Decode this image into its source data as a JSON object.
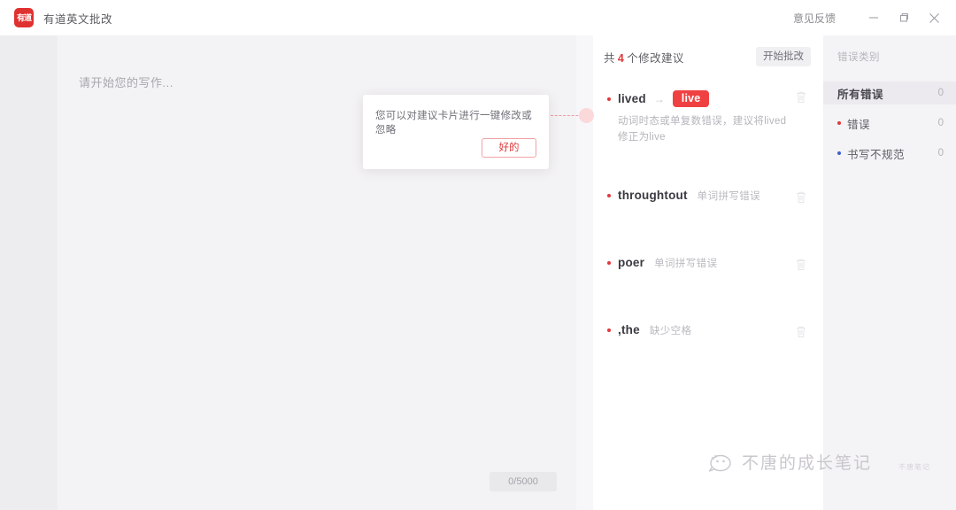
{
  "titlebar": {
    "logo_text": "有道",
    "app_title": "有道英文批改",
    "feedback_label": "意见反馈",
    "minimize_icon": "minimize-icon",
    "maximize_icon": "maximize-icon",
    "close_icon": "close-icon"
  },
  "editor": {
    "placeholder": "请开始您的写作...",
    "char_counter": "0/5000"
  },
  "suggestions_panel": {
    "count_prefix": "共",
    "count": "4",
    "count_suffix": "个修改建议",
    "start_button": "开始批改",
    "cards": [
      {
        "word": "lived",
        "arrow": "→",
        "replacement": "live",
        "error_type": "",
        "description": "动词时态或单复数错误，建议将lived修正为live",
        "delete_icon": "trash-icon"
      },
      {
        "word": "throughtout",
        "arrow": "",
        "replacement": "",
        "error_type": "单词拼写错误",
        "description": "",
        "delete_icon": "trash-icon"
      },
      {
        "word": "poer",
        "arrow": "",
        "replacement": "",
        "error_type": "单词拼写错误",
        "description": "",
        "delete_icon": "trash-icon"
      },
      {
        "word": ",the",
        "arrow": "",
        "replacement": "",
        "error_type": "缺少空格",
        "description": "",
        "delete_icon": "trash-icon"
      }
    ]
  },
  "category_sidebar": {
    "title": "错误类别",
    "rows": [
      {
        "label": "所有错误",
        "value": "0",
        "dot": "none"
      },
      {
        "label": "错误",
        "value": "0",
        "dot": "red"
      },
      {
        "label": "书写不规范",
        "value": "0",
        "dot": "blue"
      }
    ]
  },
  "coach_mark": {
    "message": "您可以对建议卡片进行一键修改或忽略",
    "ok_button": "好的"
  },
  "watermark": {
    "text": "不唐的成长笔记",
    "icon": "wechat-smiley-icon",
    "badge": "不唐笔记"
  },
  "colors": {
    "brand_red": "#e0393c",
    "badge_red": "#f04142",
    "category_blue": "#3f5fd0",
    "panel_bg": "#ffffff",
    "workspace_bg": "#f4f4f6",
    "editor_bg": "#f3f2f4",
    "sidebar_bg": "#f4f3f5"
  }
}
